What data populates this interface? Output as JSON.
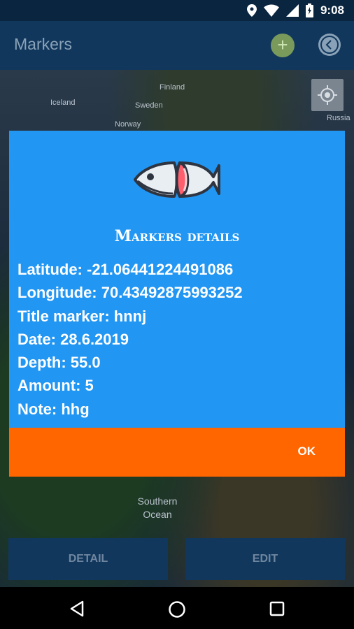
{
  "status_bar": {
    "time": "9:08"
  },
  "app_bar": {
    "title": "Markers",
    "add_icon": "plus-icon",
    "back_icon": "chevron-left-icon"
  },
  "map": {
    "labels": {
      "finland": "Finland",
      "iceland": "Iceland",
      "sweden": "Sweden",
      "norway": "Norway",
      "russia": "Russia",
      "southern_ocean": "Southern Ocean"
    },
    "locate_icon": "crosshair-icon"
  },
  "buttons": {
    "detail": "DETAIL",
    "edit": "EDIT"
  },
  "dialog": {
    "title": "Markers details",
    "lines": {
      "latitude": "Latitude: -21.06441224491086",
      "longitude": "Longitude: 70.43492875993252",
      "title_marker": "Title marker: hnnj",
      "date": "Date: 28.6.2019",
      "depth": "Depth: 55.0",
      "amount": "Amount: 5",
      "note": "Note: hhg"
    },
    "ok": "OK",
    "colors": {
      "body": "#2196f3",
      "footer": "#ff6600"
    }
  }
}
